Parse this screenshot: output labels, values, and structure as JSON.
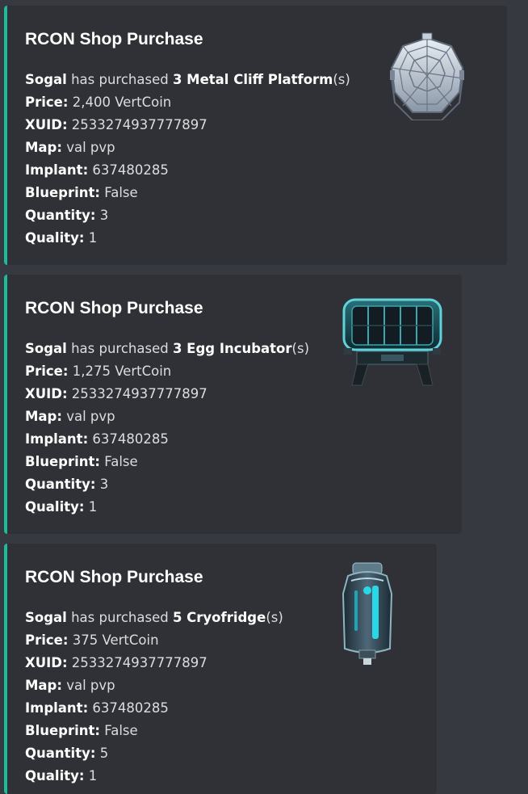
{
  "embeds": [
    {
      "title": "RCON Shop Purchase",
      "player": "Sogal",
      "purchase_mid": " has purchased ",
      "item": "3 Metal Cliff Platform",
      "suffix": "(s)",
      "fields": [
        {
          "label": "Price:",
          "value": " 2,400 VertCoin"
        },
        {
          "label": "XUID:",
          "value": " 2533274937777897"
        },
        {
          "label": "Map:",
          "value": " val pvp"
        },
        {
          "label": "Implant:",
          "value": " 637480285"
        },
        {
          "label": "Blueprint:",
          "value": " False"
        },
        {
          "label": "Quantity:",
          "value": " 3"
        },
        {
          "label": "Quality:",
          "value": " 1"
        }
      ],
      "thumbnail_icon": "metal-cliff-platform-icon"
    },
    {
      "title": "RCON Shop Purchase",
      "player": "Sogal",
      "purchase_mid": " has purchased ",
      "item": "3 Egg Incubator",
      "suffix": "(s)",
      "fields": [
        {
          "label": "Price:",
          "value": " 1,275 VertCoin"
        },
        {
          "label": "XUID:",
          "value": " 2533274937777897"
        },
        {
          "label": "Map:",
          "value": " val pvp"
        },
        {
          "label": "Implant:",
          "value": " 637480285"
        },
        {
          "label": "Blueprint:",
          "value": " False"
        },
        {
          "label": "Quantity:",
          "value": " 3"
        },
        {
          "label": "Quality:",
          "value": " 1"
        }
      ],
      "thumbnail_icon": "egg-incubator-icon"
    },
    {
      "title": "RCON Shop Purchase",
      "player": "Sogal",
      "purchase_mid": " has purchased ",
      "item": "5 Cryofridge",
      "suffix": "(s)",
      "fields": [
        {
          "label": "Price:",
          "value": " 375 VertCoin"
        },
        {
          "label": "XUID:",
          "value": " 2533274937777897"
        },
        {
          "label": "Map:",
          "value": " val pvp"
        },
        {
          "label": "Implant:",
          "value": " 637480285"
        },
        {
          "label": "Blueprint:",
          "value": " False"
        },
        {
          "label": "Quantity:",
          "value": " 5"
        },
        {
          "label": "Quality:",
          "value": " 1"
        }
      ],
      "thumbnail_icon": "cryofridge-icon"
    }
  ],
  "colors": {
    "background": "#36393f",
    "embed_background": "#2f3136",
    "embed_accent": "#1abc9c",
    "title": "#ffffff",
    "text": "#dcddde"
  }
}
